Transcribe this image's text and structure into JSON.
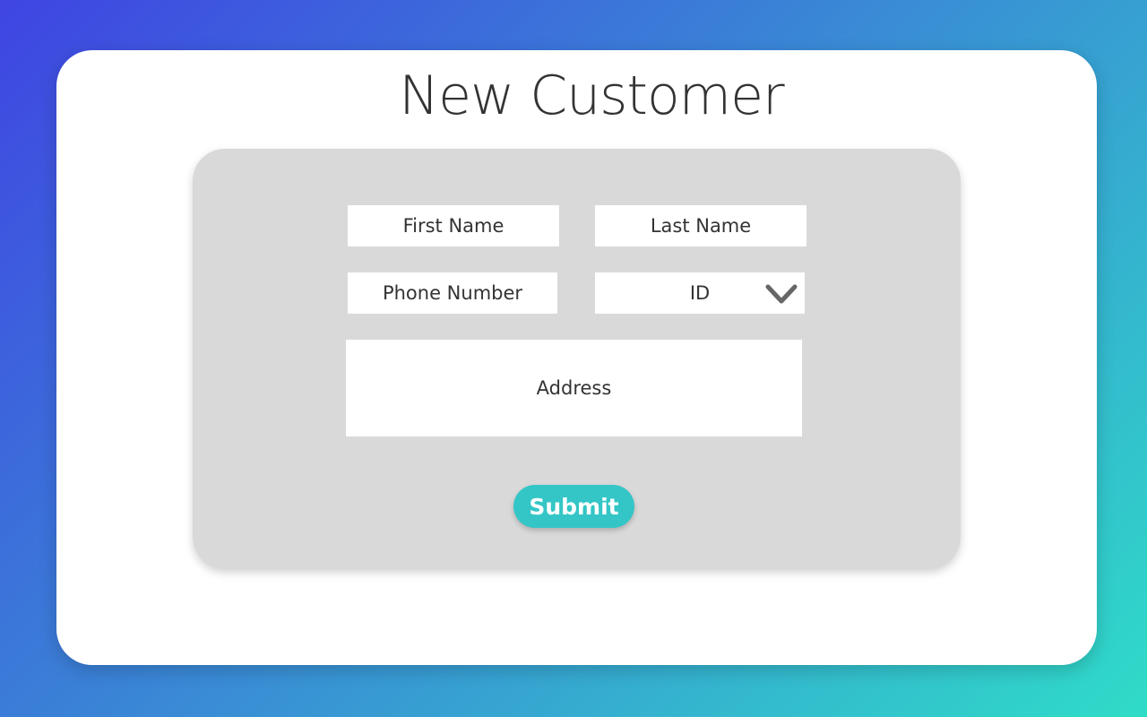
{
  "page": {
    "title": "New Customer"
  },
  "form": {
    "first_name": {
      "placeholder": "First Name",
      "value": ""
    },
    "last_name": {
      "placeholder": "Last Name",
      "value": ""
    },
    "phone": {
      "placeholder": "Phone Number",
      "value": ""
    },
    "id_select": {
      "selected": "ID",
      "icon": "chevron-down-icon"
    },
    "address": {
      "label": "Address"
    },
    "submit_label": "Submit"
  },
  "colors": {
    "background_gradient": [
      "#3f45e2",
      "#3a86d6",
      "#2fdcc8"
    ],
    "card": "#ffffff",
    "panel": "#d9d9d9",
    "accent": "#34c6c6",
    "text": "#333333"
  }
}
